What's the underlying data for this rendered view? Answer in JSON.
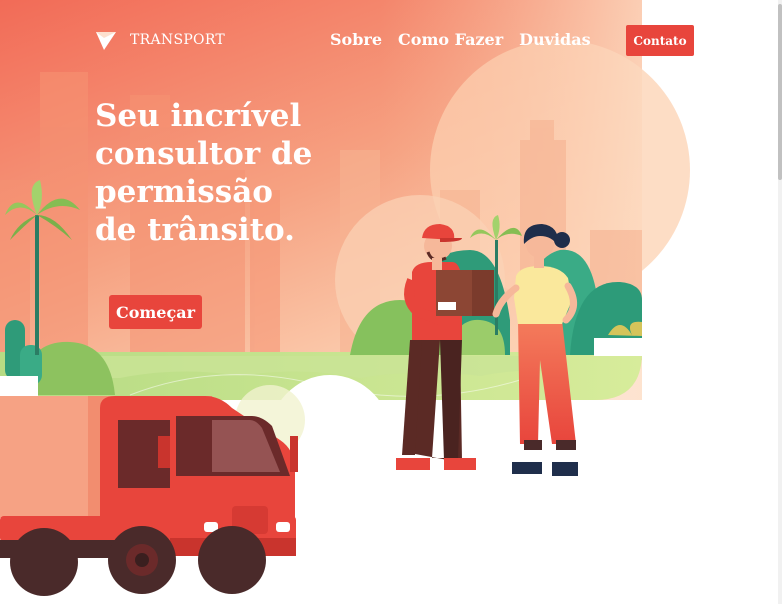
{
  "brand": {
    "name": "TRANSPORT",
    "logo_icon": "paper-plane-icon"
  },
  "nav": {
    "items": [
      "Sobre",
      "Como Fazer",
      "Duvidas"
    ],
    "contact_label": "Contato"
  },
  "hero": {
    "headline_lines": [
      "Seu incrível",
      "consultor de",
      "permissão",
      "de trânsito."
    ],
    "cta_label": "Começar"
  },
  "colors": {
    "accent": "#e8453c",
    "hero_gradient_top": "#f06b55",
    "hero_gradient_bottom": "#fbc7a6",
    "grass": "#a7d17a",
    "truck_red": "#e8453c",
    "truck_dark": "#4a2a2a"
  }
}
